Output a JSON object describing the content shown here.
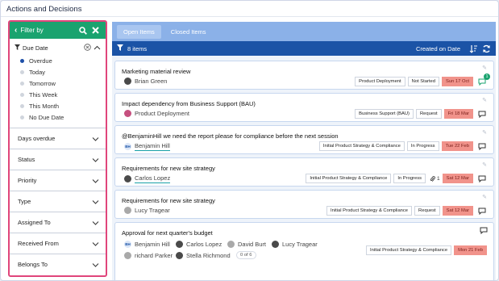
{
  "page": {
    "title": "Actions and Decisions"
  },
  "filter": {
    "header_label": "Filter by",
    "due_date": {
      "label": "Due Date",
      "selected": "Overdue",
      "options": [
        "Overdue",
        "Today",
        "Tomorrow",
        "This Week",
        "This Month",
        "No Due Date"
      ]
    },
    "sections": [
      "Days overdue",
      "Status",
      "Priority",
      "Type",
      "Assigned To",
      "Received From",
      "Belongs To"
    ]
  },
  "tabs": [
    {
      "label": "Open Items",
      "active": true
    },
    {
      "label": "Closed Items",
      "active": false
    }
  ],
  "list_bar": {
    "count_label": "8 items",
    "sort_label": "Created on Date"
  },
  "cards": [
    {
      "title": "Marketing material review",
      "users": [
        {
          "name": "Brian Green"
        }
      ],
      "tags": [
        "Product Deployment",
        "Not Started"
      ],
      "date": "Sun 17 Oct",
      "comment_badge": "1"
    },
    {
      "title": "Impact dependency from Business Support (BAU)",
      "users": [
        {
          "name": "Product Deployment"
        }
      ],
      "tags": [
        "Business Support (BAU)",
        "Request"
      ],
      "date": "Fri 18 Mar"
    },
    {
      "title": "@BenjaminHill  we need the report please for compliance before the next session",
      "users": [
        {
          "name": "Benjamin Hill",
          "initials": "BH"
        }
      ],
      "tags": [
        "Initial Product Strategy & Compliance",
        "In Progress"
      ],
      "date": "Tue 22 Feb"
    },
    {
      "title": "Requirements for new site strategy",
      "users": [
        {
          "name": "Carlos Lopez"
        }
      ],
      "tags": [
        "Initial Product Strategy & Compliance",
        "In Progress"
      ],
      "attachments": "1",
      "date": "Sat 12 Mar"
    },
    {
      "title": "Requirements for new site strategy",
      "users": [
        {
          "name": "Lucy Tragear"
        }
      ],
      "tags": [
        "Initial Product Strategy & Compliance",
        "Request"
      ],
      "date": "Sat 12 Mar"
    },
    {
      "title": "Approval for next quarter's budget",
      "users": [
        {
          "name": "Benjamin Hill",
          "initials": "BH"
        },
        {
          "name": "Carlos Lopez"
        },
        {
          "name": "David Burt"
        },
        {
          "name": "Lucy Tragear"
        },
        {
          "name": "richard Parker"
        },
        {
          "name": "Stella Richmond"
        }
      ],
      "approval_count": "0 of 6",
      "tags": [
        "Initial Product Strategy & Compliance"
      ],
      "date": "Mon 21 Feb"
    }
  ],
  "colors": {
    "filter_header": "#1aa36f",
    "highlight_border": "#e0457b",
    "list_bar": "#1b53a6",
    "tabs_bar": "#8bb1e8",
    "date_badge": "#f1938b"
  },
  "icons": [
    "chevron-left-icon",
    "search-icon",
    "close-icon",
    "filter-icon",
    "clear-icon",
    "chevron-up-icon",
    "chevron-down-icon",
    "sort-icon",
    "refresh-icon",
    "comment-icon",
    "pencil-icon",
    "paperclip-icon"
  ]
}
